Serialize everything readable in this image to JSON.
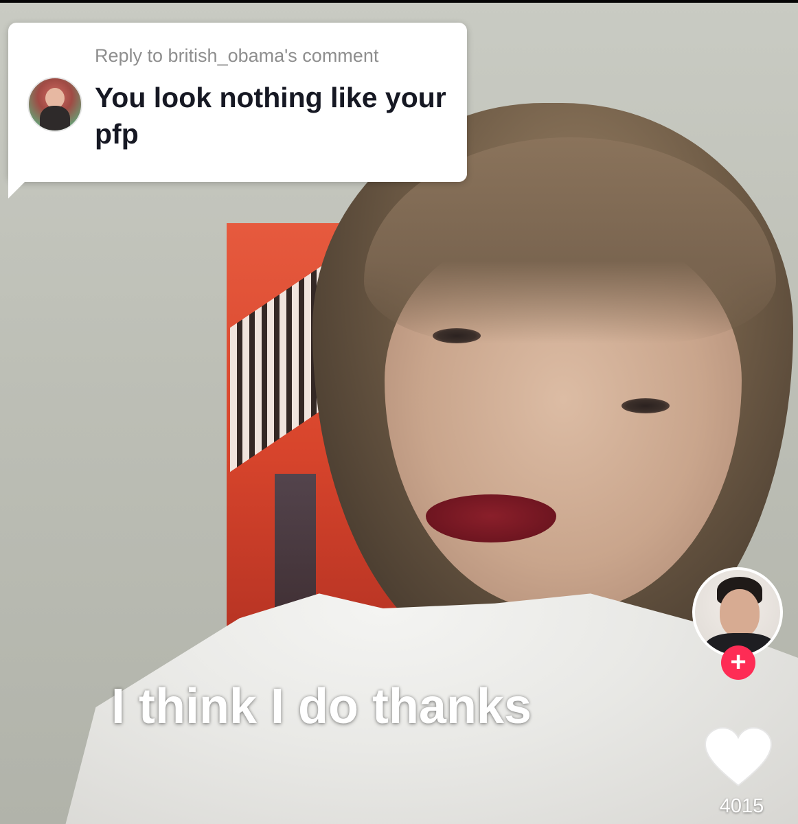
{
  "reply_sticker": {
    "header": "Reply to british_obama's comment",
    "comment_text": "You look nothing like your pfp",
    "commenter_avatar_icon": "user-avatar"
  },
  "video": {
    "caption": "I think I do thanks"
  },
  "sidebar": {
    "creator_avatar_icon": "creator-avatar",
    "follow_symbol": "+",
    "follow_color": "#fe2c55",
    "like_icon": "heart-icon",
    "like_count": "4015"
  }
}
